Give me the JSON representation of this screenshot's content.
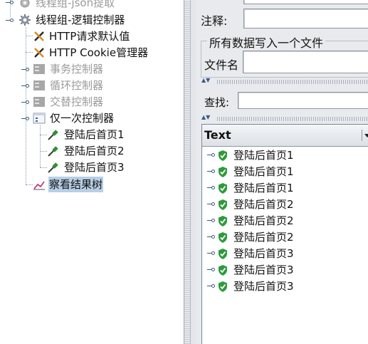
{
  "tree": {
    "items": [
      {
        "label": "线程组-json提取",
        "icon": "gear-icon",
        "disabled": true
      },
      {
        "label": "线程组-逻辑控制器",
        "icon": "gear-icon",
        "disabled": false
      },
      {
        "label": "HTTP请求默认值",
        "icon": "wrench-icon",
        "disabled": false
      },
      {
        "label": "HTTP Cookie管理器",
        "icon": "wrench-icon",
        "disabled": false
      },
      {
        "label": "事务控制器",
        "icon": "controller-icon",
        "disabled": true
      },
      {
        "label": "循环控制器",
        "icon": "controller-icon",
        "disabled": true
      },
      {
        "label": "交替控制器",
        "icon": "controller-icon",
        "disabled": true
      },
      {
        "label": "仅一次控制器",
        "icon": "controller-icon",
        "disabled": false
      },
      {
        "label": "登陆后首页1",
        "icon": "sampler-pipette-icon",
        "disabled": false
      },
      {
        "label": "登陆后首页2",
        "icon": "sampler-pipette-icon",
        "disabled": false
      },
      {
        "label": "登陆后首页3",
        "icon": "sampler-pipette-icon",
        "disabled": false
      },
      {
        "label": "察看结果树",
        "icon": "results-tree-icon",
        "disabled": false,
        "selected": true
      }
    ]
  },
  "panel": {
    "comment_label": "注释:",
    "comment_value": "",
    "file_group_title": "所有数据写入一个文件",
    "filename_label": "文件名",
    "filename_value": "",
    "search_label": "查找:",
    "search_value": "",
    "results_header": "Text",
    "results": [
      {
        "label": "登陆后首页1",
        "status": "success"
      },
      {
        "label": "登陆后首页1",
        "status": "success"
      },
      {
        "label": "登陆后首页1",
        "status": "success"
      },
      {
        "label": "登陆后首页2",
        "status": "success"
      },
      {
        "label": "登陆后首页2",
        "status": "success"
      },
      {
        "label": "登陆后首页2",
        "status": "success"
      },
      {
        "label": "登陆后首页3",
        "status": "success"
      },
      {
        "label": "登陆后首页3",
        "status": "success"
      },
      {
        "label": "登陆后首页3",
        "status": "success"
      }
    ]
  },
  "colors": {
    "selection": "#b8cfe5",
    "success_shield": "#2e9b3a",
    "disabled_text": "#9a9a9a"
  }
}
